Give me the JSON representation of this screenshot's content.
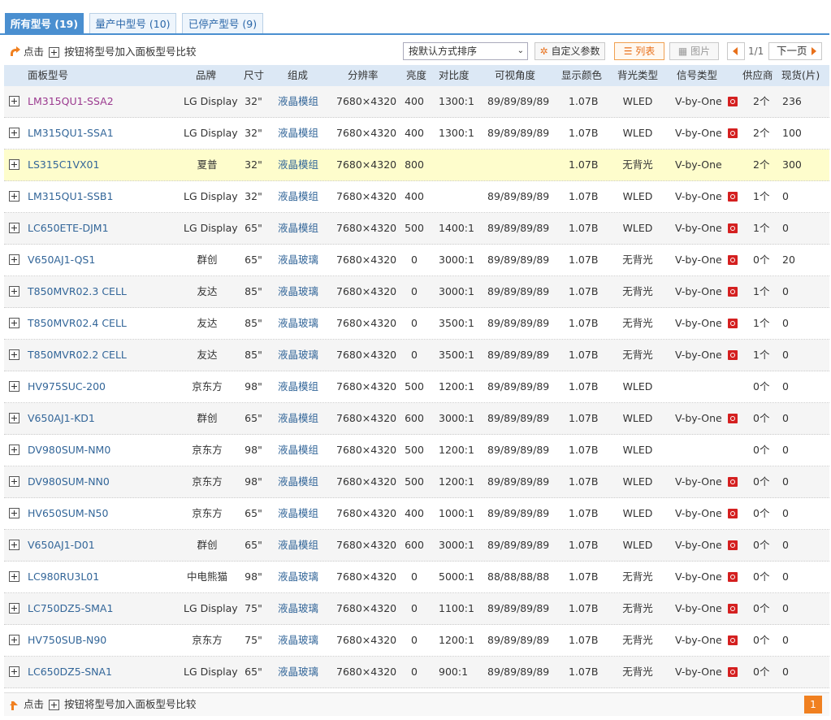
{
  "tabs": [
    {
      "label": "所有型号 (19)",
      "active": true
    },
    {
      "label": "量产中型号 (10)",
      "active": false
    },
    {
      "label": "已停产型号 (9)",
      "active": false
    }
  ],
  "toolbar": {
    "hint_click": "点击",
    "hint_rest": "按钮将型号加入面板型号比较",
    "sort_value": "按默认方式排序",
    "custom_params_label": "自定义参数",
    "list_view_label": "列表",
    "image_view_label": "图片",
    "pager_count": "1/1",
    "next_page_label": "下一页"
  },
  "columns": [
    "面板型号",
    "品牌",
    "尺寸",
    "组成",
    "分辨率",
    "亮度",
    "对比度",
    "可视角度",
    "显示颜色",
    "背光类型",
    "信号类型",
    "供应商",
    "现货(片)"
  ],
  "rows": [
    {
      "model": "LM315QU1-SSA2",
      "brand": "LG Display",
      "size": "32\"",
      "comp": "液晶模组",
      "res": "7680×4320",
      "bright": "400",
      "contrast": "1300:1",
      "angle": "89/89/89/89",
      "color": "1.07B",
      "backlight": "WLED",
      "signal": "V-by-One",
      "pdf": true,
      "supplier": "2个",
      "stock": "236",
      "visited": true
    },
    {
      "model": "LM315QU1-SSA1",
      "brand": "LG Display",
      "size": "32\"",
      "comp": "液晶模组",
      "res": "7680×4320",
      "bright": "400",
      "contrast": "1300:1",
      "angle": "89/89/89/89",
      "color": "1.07B",
      "backlight": "WLED",
      "signal": "V-by-One",
      "pdf": true,
      "supplier": "2个",
      "stock": "100"
    },
    {
      "model": "LS315C1VX01",
      "brand": "夏普",
      "size": "32\"",
      "comp": "液晶模组",
      "res": "7680×4320",
      "bright": "800",
      "contrast": "",
      "angle": "",
      "color": "1.07B",
      "backlight": "无背光",
      "signal": "V-by-One",
      "pdf": false,
      "supplier": "2个",
      "stock": "300",
      "highlight": true
    },
    {
      "model": "LM315QU1-SSB1",
      "brand": "LG Display",
      "size": "32\"",
      "comp": "液晶模组",
      "res": "7680×4320",
      "bright": "400",
      "contrast": "",
      "angle": "89/89/89/89",
      "color": "1.07B",
      "backlight": "WLED",
      "signal": "V-by-One",
      "pdf": true,
      "supplier": "1个",
      "stock": "0"
    },
    {
      "model": "LC650ETE-DJM1",
      "brand": "LG Display",
      "size": "65\"",
      "comp": "液晶模组",
      "res": "7680×4320",
      "bright": "500",
      "contrast": "1400:1",
      "angle": "89/89/89/89",
      "color": "1.07B",
      "backlight": "WLED",
      "signal": "V-by-One",
      "pdf": true,
      "supplier": "1个",
      "stock": "0"
    },
    {
      "model": "V650AJ1-QS1",
      "brand": "群创",
      "size": "65\"",
      "comp": "液晶玻璃",
      "res": "7680×4320",
      "bright": "0",
      "contrast": "3000:1",
      "angle": "89/89/89/89",
      "color": "1.07B",
      "backlight": "无背光",
      "signal": "V-by-One",
      "pdf": true,
      "supplier": "0个",
      "stock": "20"
    },
    {
      "model": "T850MVR02.3 CELL",
      "brand": "友达",
      "size": "85\"",
      "comp": "液晶玻璃",
      "res": "7680×4320",
      "bright": "0",
      "contrast": "3000:1",
      "angle": "89/89/89/89",
      "color": "1.07B",
      "backlight": "无背光",
      "signal": "V-by-One",
      "pdf": true,
      "supplier": "1个",
      "stock": "0"
    },
    {
      "model": "T850MVR02.4 CELL",
      "brand": "友达",
      "size": "85\"",
      "comp": "液晶玻璃",
      "res": "7680×4320",
      "bright": "0",
      "contrast": "3500:1",
      "angle": "89/89/89/89",
      "color": "1.07B",
      "backlight": "无背光",
      "signal": "V-by-One",
      "pdf": true,
      "supplier": "1个",
      "stock": "0"
    },
    {
      "model": "T850MVR02.2 CELL",
      "brand": "友达",
      "size": "85\"",
      "comp": "液晶玻璃",
      "res": "7680×4320",
      "bright": "0",
      "contrast": "3500:1",
      "angle": "89/89/89/89",
      "color": "1.07B",
      "backlight": "无背光",
      "signal": "V-by-One",
      "pdf": true,
      "supplier": "1个",
      "stock": "0"
    },
    {
      "model": "HV975SUC-200",
      "brand": "京东方",
      "size": "98\"",
      "comp": "液晶模组",
      "res": "7680×4320",
      "bright": "500",
      "contrast": "1200:1",
      "angle": "89/89/89/89",
      "color": "1.07B",
      "backlight": "WLED",
      "signal": "",
      "pdf": false,
      "supplier": "0个",
      "stock": "0"
    },
    {
      "model": "V650AJ1-KD1",
      "brand": "群创",
      "size": "65\"",
      "comp": "液晶模组",
      "res": "7680×4320",
      "bright": "600",
      "contrast": "3000:1",
      "angle": "89/89/89/89",
      "color": "1.07B",
      "backlight": "WLED",
      "signal": "V-by-One",
      "pdf": true,
      "supplier": "0个",
      "stock": "0"
    },
    {
      "model": "DV980SUM-NM0",
      "brand": "京东方",
      "size": "98\"",
      "comp": "液晶模组",
      "res": "7680×4320",
      "bright": "500",
      "contrast": "1200:1",
      "angle": "89/89/89/89",
      "color": "1.07B",
      "backlight": "WLED",
      "signal": "",
      "pdf": false,
      "supplier": "0个",
      "stock": "0"
    },
    {
      "model": "DV980SUM-NN0",
      "brand": "京东方",
      "size": "98\"",
      "comp": "液晶模组",
      "res": "7680×4320",
      "bright": "500",
      "contrast": "1200:1",
      "angle": "89/89/89/89",
      "color": "1.07B",
      "backlight": "WLED",
      "signal": "V-by-One",
      "pdf": true,
      "supplier": "0个",
      "stock": "0"
    },
    {
      "model": "HV650SUM-N50",
      "brand": "京东方",
      "size": "65\"",
      "comp": "液晶模组",
      "res": "7680×4320",
      "bright": "400",
      "contrast": "1000:1",
      "angle": "89/89/89/89",
      "color": "1.07B",
      "backlight": "WLED",
      "signal": "V-by-One",
      "pdf": true,
      "supplier": "0个",
      "stock": "0"
    },
    {
      "model": "V650AJ1-D01",
      "brand": "群创",
      "size": "65\"",
      "comp": "液晶模组",
      "res": "7680×4320",
      "bright": "600",
      "contrast": "3000:1",
      "angle": "89/89/89/89",
      "color": "1.07B",
      "backlight": "WLED",
      "signal": "V-by-One",
      "pdf": true,
      "supplier": "0个",
      "stock": "0"
    },
    {
      "model": "LC980RU3L01",
      "brand": "中电熊猫",
      "size": "98\"",
      "comp": "液晶玻璃",
      "res": "7680×4320",
      "bright": "0",
      "contrast": "5000:1",
      "angle": "88/88/88/88",
      "color": "1.07B",
      "backlight": "无背光",
      "signal": "V-by-One",
      "pdf": true,
      "supplier": "0个",
      "stock": "0"
    },
    {
      "model": "LC750DZ5-SMA1",
      "brand": "LG Display",
      "size": "75\"",
      "comp": "液晶玻璃",
      "res": "7680×4320",
      "bright": "0",
      "contrast": "1100:1",
      "angle": "89/89/89/89",
      "color": "1.07B",
      "backlight": "无背光",
      "signal": "V-by-One",
      "pdf": true,
      "supplier": "0个",
      "stock": "0"
    },
    {
      "model": "HV750SUB-N90",
      "brand": "京东方",
      "size": "75\"",
      "comp": "液晶玻璃",
      "res": "7680×4320",
      "bright": "0",
      "contrast": "1200:1",
      "angle": "89/89/89/89",
      "color": "1.07B",
      "backlight": "无背光",
      "signal": "V-by-One",
      "pdf": true,
      "supplier": "0个",
      "stock": "0"
    },
    {
      "model": "LC650DZ5-SNA1",
      "brand": "LG Display",
      "size": "65\"",
      "comp": "液晶玻璃",
      "res": "7680×4320",
      "bright": "0",
      "contrast": "900:1",
      "angle": "89/89/89/89",
      "color": "1.07B",
      "backlight": "无背光",
      "signal": "V-by-One",
      "pdf": true,
      "supplier": "0个",
      "stock": "0"
    }
  ],
  "footer": {
    "hint_click": "点击",
    "hint_rest": "按钮将型号加入面板型号比较",
    "current_page": "1"
  },
  "colors": {
    "accent": "#4a8fd0",
    "highlight_row": "#fefdcc",
    "link": "#336699",
    "pdf_icon": "#d42020",
    "page_active": "#f08020"
  }
}
